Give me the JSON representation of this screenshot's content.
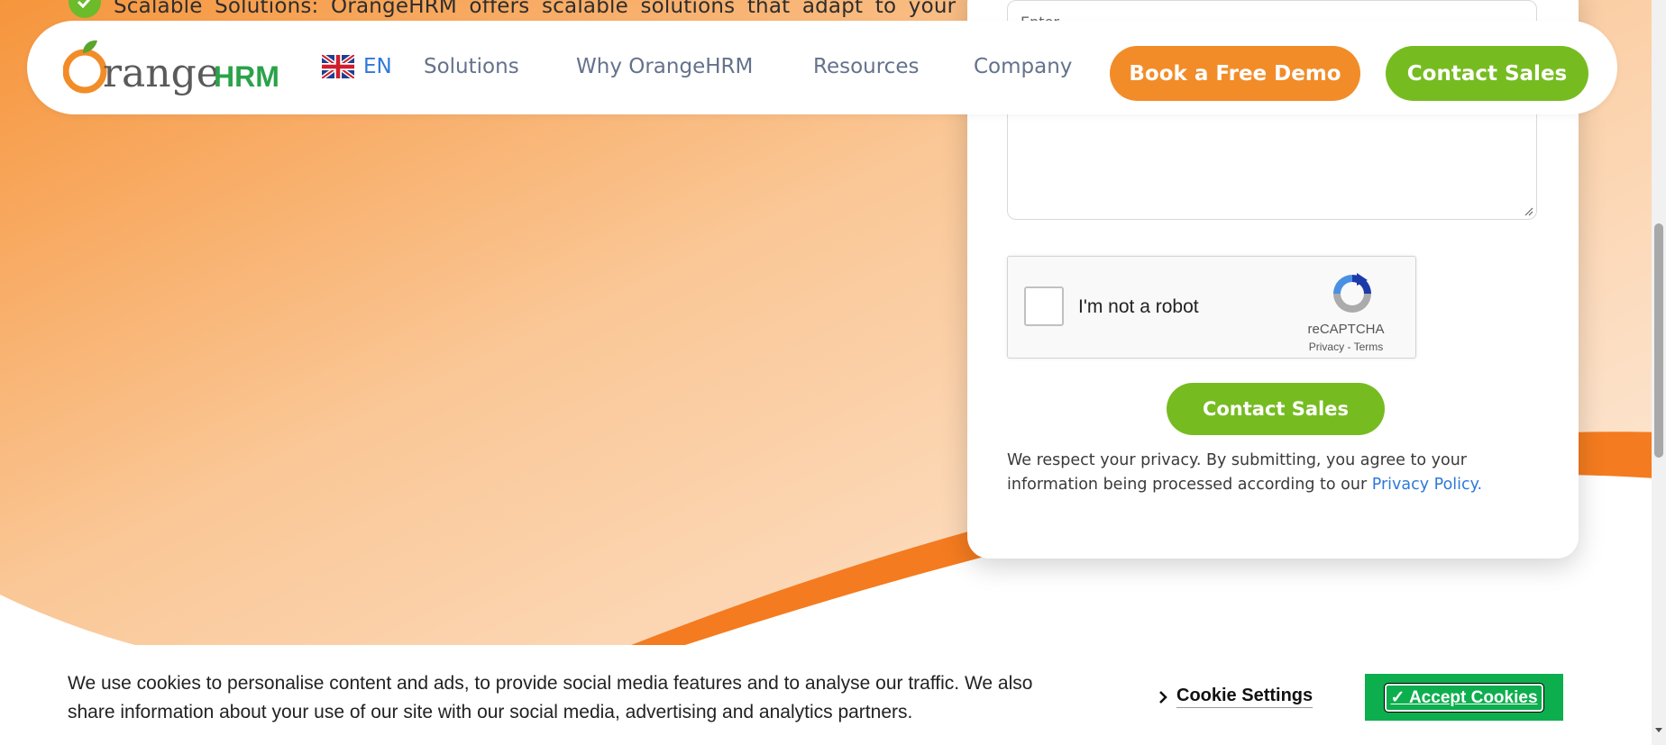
{
  "top_partial": {
    "text": "Scalable Solutions: OrangeHRM offers scalable solutions that adapt to your"
  },
  "header": {
    "logo_text_main": "rangeHRM",
    "logo_text_orange": "O",
    "lang_label": "EN",
    "nav": [
      "Solutions",
      "Why OrangeHRM",
      "Resources",
      "Company"
    ],
    "demo_button": "Book a Free Demo",
    "contact_button": "Contact Sales"
  },
  "form": {
    "textarea_placeholder": "Enter",
    "recaptcha": {
      "label": "I'm not a robot",
      "brand": "reCAPTCHA",
      "privacy_link": "Privacy",
      "separator": " - ",
      "terms_link": "Terms"
    },
    "submit_button": "Contact Sales",
    "privacy_text": "We respect your privacy. By submitting, you agree to your information being processed according to our ",
    "privacy_link": "Privacy Policy."
  },
  "cookie_bar": {
    "text": "We use cookies to personalise content and ads, to provide social media features and to analyse our traffic. We also share information about your use of our site with our social media, advertising and analytics partners.",
    "settings_label": "Cookie Settings",
    "accept_label": "✓ Accept Cookies"
  },
  "colors": {
    "orange": "#f28c28",
    "green": "#76bc21",
    "accept_green": "#0dae4e",
    "link_blue": "#2e79d8",
    "nav_gray": "#64728c"
  }
}
